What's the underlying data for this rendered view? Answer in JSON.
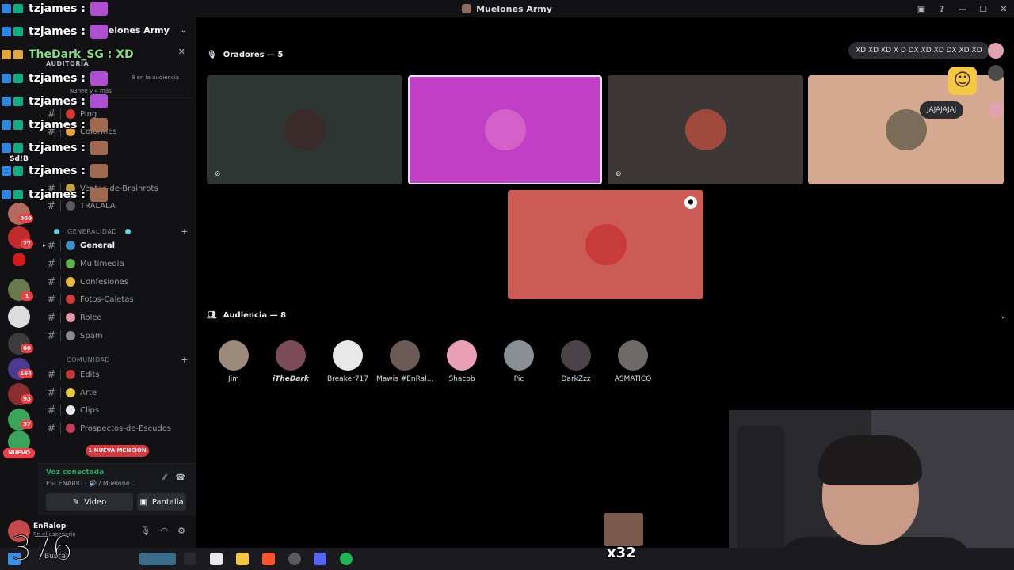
{
  "window": {
    "title": "Muelones Army",
    "controls": [
      "—",
      "☐",
      "✕"
    ]
  },
  "server_rail": {
    "badges": [
      "360",
      "27",
      "1",
      "80",
      "164",
      "93",
      "37"
    ],
    "new_label": "NUEVO"
  },
  "sidebar": {
    "server_name": "Muelones Army",
    "event": {
      "label": "AUDITORIA",
      "audience": "8 en la audiencia",
      "more": "N3nee  y 4 más"
    },
    "top_channels": [
      {
        "name": "Ping"
      },
      {
        "name": "Colorines"
      },
      {
        "name": "Ventas-de-Brainrots"
      },
      {
        "name": "TRALALA"
      }
    ],
    "categories": {
      "general": "GENERALIDAD",
      "community": "COMUNIDAD"
    },
    "channels_general": [
      {
        "name": "General",
        "active": true
      },
      {
        "name": "Multimedia"
      },
      {
        "name": "Confesiones"
      },
      {
        "name": "Fotos-Caletas"
      },
      {
        "name": "Roleo"
      },
      {
        "name": "Spam"
      }
    ],
    "channels_community": [
      {
        "name": "Edits"
      },
      {
        "name": "Arte"
      },
      {
        "name": "Clips"
      },
      {
        "name": "Prospectos-de-Escudos"
      }
    ],
    "mention_pill": "1 NUEVA MENCIÓN"
  },
  "voice_panel": {
    "status": "Voz conectada",
    "channel": "ESCENARIO · 🔊 / Muelone...",
    "video_label": "Video",
    "screen_label": "Pantalla"
  },
  "user_panel": {
    "name": "EnRalop",
    "sub": "En el escenario"
  },
  "stage": {
    "speakers_title": "Oradores — 5",
    "audience_title": "Audiencia — 8",
    "speakers": [
      {
        "id": "s1",
        "bg": "#2f3532",
        "avatar": "#3a2b2b",
        "muted": true
      },
      {
        "id": "s2",
        "bg": "#c13fc4",
        "avatar": "#d460c9",
        "speaking": true
      },
      {
        "id": "s3",
        "bg": "#3d3836",
        "avatar": "#a04a3e",
        "muted": true
      },
      {
        "id": "s4",
        "bg": "#d5a98f",
        "avatar": "#7b6b59"
      },
      {
        "id": "s5",
        "bg": "#cb5b53",
        "avatar": "#c73b3b",
        "badge": true
      }
    ],
    "audience": [
      {
        "name": "Jim",
        "color": "#9c8a7a"
      },
      {
        "name": "iTheDark",
        "color": "#7b4b57",
        "italic": true
      },
      {
        "name": "Breaker717",
        "color": "#e8e8e8"
      },
      {
        "name": "Mawis #EnRal...",
        "color": "#6b5a55"
      },
      {
        "name": "Shacob",
        "color": "#e9a0b6"
      },
      {
        "name": "Pic",
        "color": "#8a8f95"
      },
      {
        "name": "DarkZzz",
        "color": "#4a4448"
      },
      {
        "name": "ASMATICO",
        "color": "#6e6a67"
      }
    ],
    "reactions": [
      {
        "text": "XD XD XD X D DX XD XD DX XD XD"
      },
      {
        "text": "JAJAJAJAJ"
      }
    ]
  },
  "chat_overlay": {
    "lines": [
      {
        "user": "tzjames :",
        "emote": "#b04fd2"
      },
      {
        "user": "tzjames :",
        "emote": "#b04fd2"
      },
      {
        "user": "TheDark_SG : XD",
        "green": true
      },
      {
        "user": "tzjames :",
        "emote": "#b04fd2"
      },
      {
        "user": "tzjames :",
        "emote": "#b04fd2"
      },
      {
        "user": "tzjames :",
        "emote": "#a06a50"
      },
      {
        "user": "tzjames :",
        "emote": "#a06a50"
      },
      {
        "user": "tzjames :",
        "emote": "#a06a50"
      },
      {
        "user": "tzjames :",
        "emote": "#a06a50"
      }
    ],
    "side_label": "Sd!B"
  },
  "taskbar": {
    "search": "Buscar"
  },
  "overlay": {
    "counter": "376",
    "emote_count": "x32"
  }
}
